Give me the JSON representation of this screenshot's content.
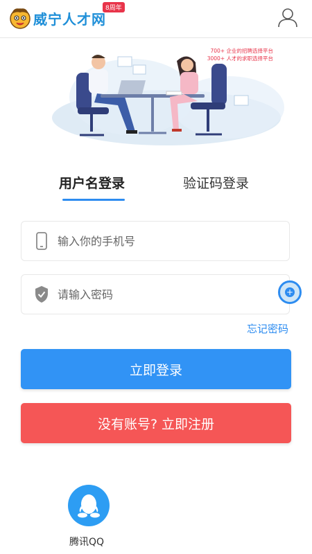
{
  "header": {
    "logo_text": "威宁人才网",
    "logo_badge": "8周年"
  },
  "banner": {
    "line1": "700+ 企业的招聘选择平台",
    "line2": "3000+ 人才的求职选择平台"
  },
  "tabs": [
    {
      "label": "用户名登录",
      "active": true
    },
    {
      "label": "验证码登录",
      "active": false
    }
  ],
  "form": {
    "phone_placeholder": "输入你的手机号",
    "password_placeholder": "请输入密码",
    "forgot_label": "忘记密码"
  },
  "buttons": {
    "login_label": "立即登录",
    "register_label": "没有账号? 立即注册"
  },
  "social": {
    "qq_label": "腾讯QQ"
  },
  "colors": {
    "primary": "#3193f5",
    "danger": "#f55656",
    "accent": "#2d8cf0"
  }
}
